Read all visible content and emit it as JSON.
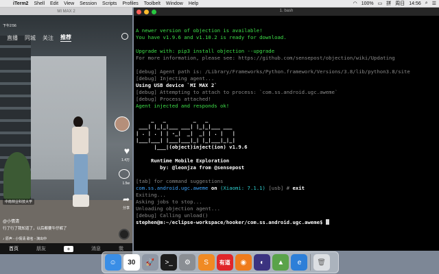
{
  "menubar": {
    "apple": "",
    "items": [
      "iTerm2",
      "Shell",
      "Edit",
      "View",
      "Session",
      "Scripts",
      "Profiles",
      "Toolbelt",
      "Window",
      "Help"
    ],
    "battery": "100%",
    "ime": "拼",
    "date": "周日",
    "time": "14:56"
  },
  "phone": {
    "window_title": "MI MAX 2",
    "status_time": "下午2:56",
    "tabs": [
      "直播",
      "同城",
      "关注",
      "推荐"
    ],
    "active_tab": "推荐",
    "likes": "1.4万",
    "comments": "1.5w",
    "shares": "分享",
    "location": "中南林业科技大学",
    "user": "@小情清",
    "description": "行了行了我知道了，以后都要牛仔裤了",
    "music": "♪ 原声 - 小情清   歌名 - 演出中",
    "nav": [
      "首页",
      "朋友",
      "+",
      "消息",
      "我"
    ]
  },
  "terminal": {
    "title": "1. bash",
    "lines": [
      {
        "text": "A newer version of objection is available!",
        "cls": "c-g"
      },
      {
        "text": "You have v1.9.6 and v1.10.2 is ready for download.",
        "cls": "c-g"
      },
      {
        "text": "",
        "cls": ""
      },
      {
        "text": "Upgrade with: pip3 install objection --upgrade",
        "cls": "c-g"
      },
      {
        "text": "For more information, please see: https://github.com/sensepost/objection/wiki/Updating",
        "cls": "c-gray"
      },
      {
        "text": "",
        "cls": ""
      },
      {
        "text": "[debug] Agent path is: /Library/Frameworks/Python.framework/Versions/3.8/lib/python3.8/site",
        "cls": "c-gray"
      },
      {
        "text": "[debug] Injecting agent...",
        "cls": "c-gray"
      },
      {
        "text": "Using USB device `MI MAX 2`",
        "cls": "c-w"
      },
      {
        "text": "[debug] Attempting to attach to process: `com.ss.android.ugc.aweme`",
        "cls": "c-gray"
      },
      {
        "text": "[debug] Process attached!",
        "cls": "c-gray"
      },
      {
        "text": "Agent injected and responds ok!",
        "cls": "c-g"
      },
      {
        "text": "",
        "cls": ""
      },
      {
        "text": "     _   _         _   _",
        "cls": "c-w"
      },
      {
        "text": " ___| |_|_|___ ___| |_|_|___ ___",
        "cls": "c-w"
      },
      {
        "text": "| . | . | | -_|  _|  _| | . |   |",
        "cls": "c-w"
      },
      {
        "text": "|___|___| |___|___|_| |_|___|_|_|",
        "cls": "c-w"
      },
      {
        "text": "      |___|(object)inject(ion) v1.9.6",
        "cls": "c-w"
      },
      {
        "text": "",
        "cls": ""
      },
      {
        "text": "     Runtime Mobile Exploration",
        "cls": "c-w"
      },
      {
        "text": "        by: @leonjza from @sensepost",
        "cls": "c-w"
      },
      {
        "text": "",
        "cls": ""
      },
      {
        "text": "[tab] for command suggestions",
        "cls": "c-dim"
      }
    ],
    "prompt": {
      "pkg": "com.ss.android.ugc.aweme",
      "on": " on ",
      "device": "(Xiaomi: 7.1.1)",
      "usb": " [usb] # ",
      "cmd": "exit"
    },
    "after": [
      {
        "text": "Exiting...",
        "cls": "c-gray"
      },
      {
        "text": "Asking jobs to stop...",
        "cls": "c-gray"
      },
      {
        "text": "Unloading objection agent...",
        "cls": "c-gray"
      },
      {
        "text": "[debug] Calling unload()",
        "cls": "c-gray"
      }
    ],
    "shell_prompt": "stephen@m:~/eclipse-workspace/hooker/com.ss.android.ugc.aweme$ "
  },
  "dock": {
    "items": [
      {
        "name": "finder",
        "color": "#3a8ee6",
        "glyph": "☺"
      },
      {
        "name": "calendar",
        "color": "#ffffff",
        "glyph": "30"
      },
      {
        "name": "launchpad",
        "color": "#8f98a6",
        "glyph": "🚀"
      },
      {
        "name": "terminal",
        "color": "#1d1d1d",
        "glyph": ">_"
      },
      {
        "name": "system-preferences",
        "color": "#8a8e93",
        "glyph": "⚙"
      },
      {
        "name": "sublime",
        "color": "#f08a24",
        "glyph": "S"
      },
      {
        "name": "youdao",
        "color": "#e0262a",
        "glyph": "有道"
      },
      {
        "name": "firefox",
        "color": "#ef7b1c",
        "glyph": "◉"
      },
      {
        "name": "eclipse",
        "color": "#3b3380",
        "glyph": "◐"
      },
      {
        "name": "android-studio",
        "color": "#5aa34a",
        "glyph": "▲"
      },
      {
        "name": "qq-browser",
        "color": "#2d7fd8",
        "glyph": "e"
      },
      {
        "name": "trash",
        "color": "#dcdfe3",
        "glyph": "🗑"
      }
    ]
  }
}
